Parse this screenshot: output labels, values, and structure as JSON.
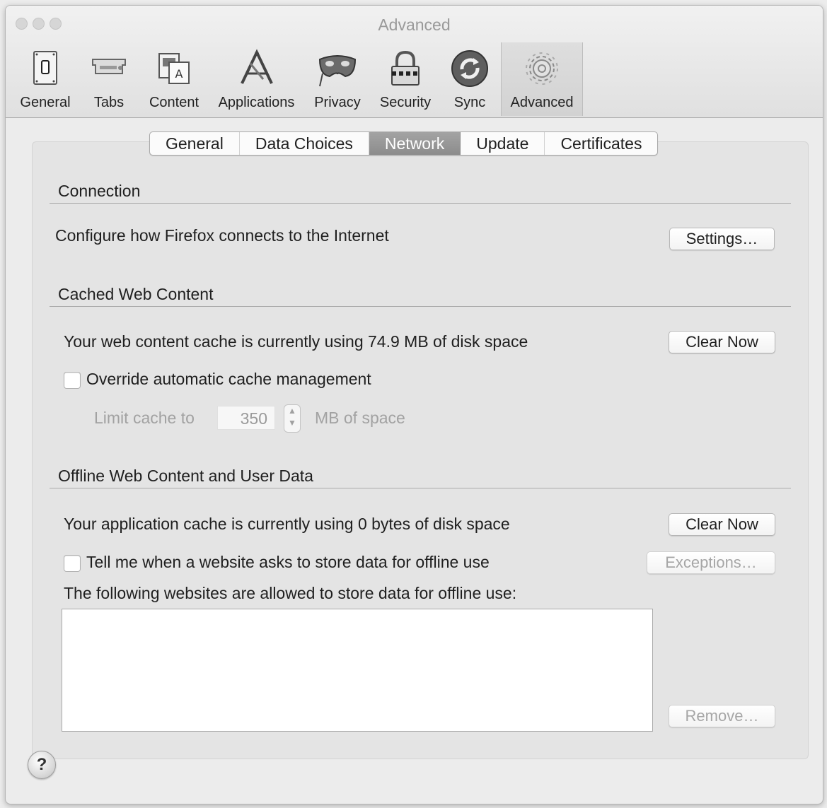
{
  "window": {
    "title": "Advanced"
  },
  "toolbar": {
    "items": [
      {
        "label": "General",
        "icon": "general-switch-icon"
      },
      {
        "label": "Tabs",
        "icon": "tabs-icon"
      },
      {
        "label": "Content",
        "icon": "content-icon"
      },
      {
        "label": "Applications",
        "icon": "applications-icon"
      },
      {
        "label": "Privacy",
        "icon": "privacy-mask-icon"
      },
      {
        "label": "Security",
        "icon": "security-lock-icon"
      },
      {
        "label": "Sync",
        "icon": "sync-icon"
      },
      {
        "label": "Advanced",
        "icon": "advanced-gear-icon",
        "selected": true
      }
    ]
  },
  "tabs": {
    "items": [
      "General",
      "Data Choices",
      "Network",
      "Update",
      "Certificates"
    ],
    "active": "Network"
  },
  "connection": {
    "heading": "Connection",
    "description": "Configure how Firefox connects to the Internet",
    "settings_button": "Settings…"
  },
  "cached": {
    "heading": "Cached Web Content",
    "usage_text": "Your web content cache is currently using 74.9 MB of disk space",
    "clear_button": "Clear Now",
    "override_label": "Override automatic cache management",
    "override_checked": false,
    "limit_label": "Limit cache to",
    "limit_value": "350",
    "limit_unit": "MB of space"
  },
  "offline": {
    "heading": "Offline Web Content and User Data",
    "usage_text": "Your application cache is currently using 0 bytes of disk space",
    "clear_button": "Clear Now",
    "tell_me_label": "Tell me when a website asks to store data for offline use",
    "tell_me_checked": false,
    "exceptions_button": "Exceptions…",
    "allowed_label": "The following websites are allowed to store data for offline use:",
    "allowed_sites": [],
    "remove_button": "Remove…"
  },
  "help": {
    "label": "?"
  }
}
